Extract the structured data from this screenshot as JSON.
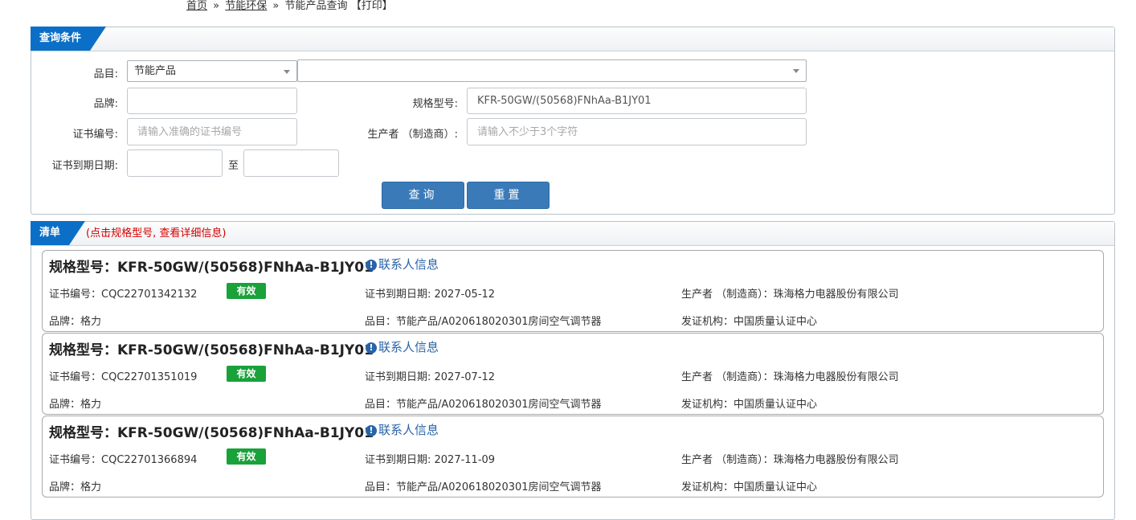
{
  "breadcrumb": {
    "home": "首页",
    "sep1": "»",
    "category": "节能环保",
    "sep2": "»",
    "current": "节能产品查询",
    "print": "【打印】"
  },
  "query": {
    "title": "查询条件",
    "category_label": "品目:",
    "category_value": "节能产品",
    "subcategory_value": "",
    "brand_label": "品牌:",
    "brand_value": "",
    "model_label": "规格型号:",
    "model_value": "KFR-50GW/(50568)FNhAa-B1JY01",
    "cert_no_label": "证书编号:",
    "cert_no_placeholder": "请输入准确的证书编号",
    "maker_label": "生产者 （制造商）:",
    "maker_placeholder": "请输入不少于3个字符",
    "expiry_label": "证书到期日期:",
    "expiry_from": "",
    "expiry_to_sep": "至",
    "expiry_to": "",
    "search_button": "查询",
    "reset_button": "重置"
  },
  "results": {
    "title": "清单",
    "hint": "(点击规格型号, 查看详细信息)",
    "labels": {
      "model": "规格型号：",
      "contact": "联系人信息",
      "cert_no": "证书编号：",
      "expiry": "证书到期日期: ",
      "maker": "生产者 （制造商）：",
      "brand": "品牌：",
      "category": "品目：",
      "issuer": "发证机构："
    },
    "items": [
      {
        "model": "KFR-50GW/(50568)FNhAa-B1JY01",
        "cert_no": "CQC22701342132",
        "status": "有效",
        "expiry": "2027-05-12",
        "maker": "珠海格力电器股份有限公司",
        "brand": "格力",
        "category": "节能产品/A020618020301房间空气调节器",
        "issuer": "中国质量认证中心"
      },
      {
        "model": "KFR-50GW/(50568)FNhAa-B1JY01",
        "cert_no": "CQC22701351019",
        "status": "有效",
        "expiry": "2027-07-12",
        "maker": "珠海格力电器股份有限公司",
        "brand": "格力",
        "category": "节能产品/A020618020301房间空气调节器",
        "issuer": "中国质量认证中心"
      },
      {
        "model": "KFR-50GW/(50568)FNhAa-B1JY01",
        "cert_no": "CQC22701366894",
        "status": "有效",
        "expiry": "2027-11-09",
        "maker": "珠海格力电器股份有限公司",
        "brand": "格力",
        "category": "节能产品/A020618020301房间空气调节器",
        "issuer": "中国质量认证中心"
      }
    ]
  },
  "colors": {
    "tab_blue": "#0b6fc7",
    "button_blue": "#3a7ab8",
    "valid_green": "#19a13a",
    "hint_red": "#d60000",
    "link_blue": "#2a64a8"
  }
}
